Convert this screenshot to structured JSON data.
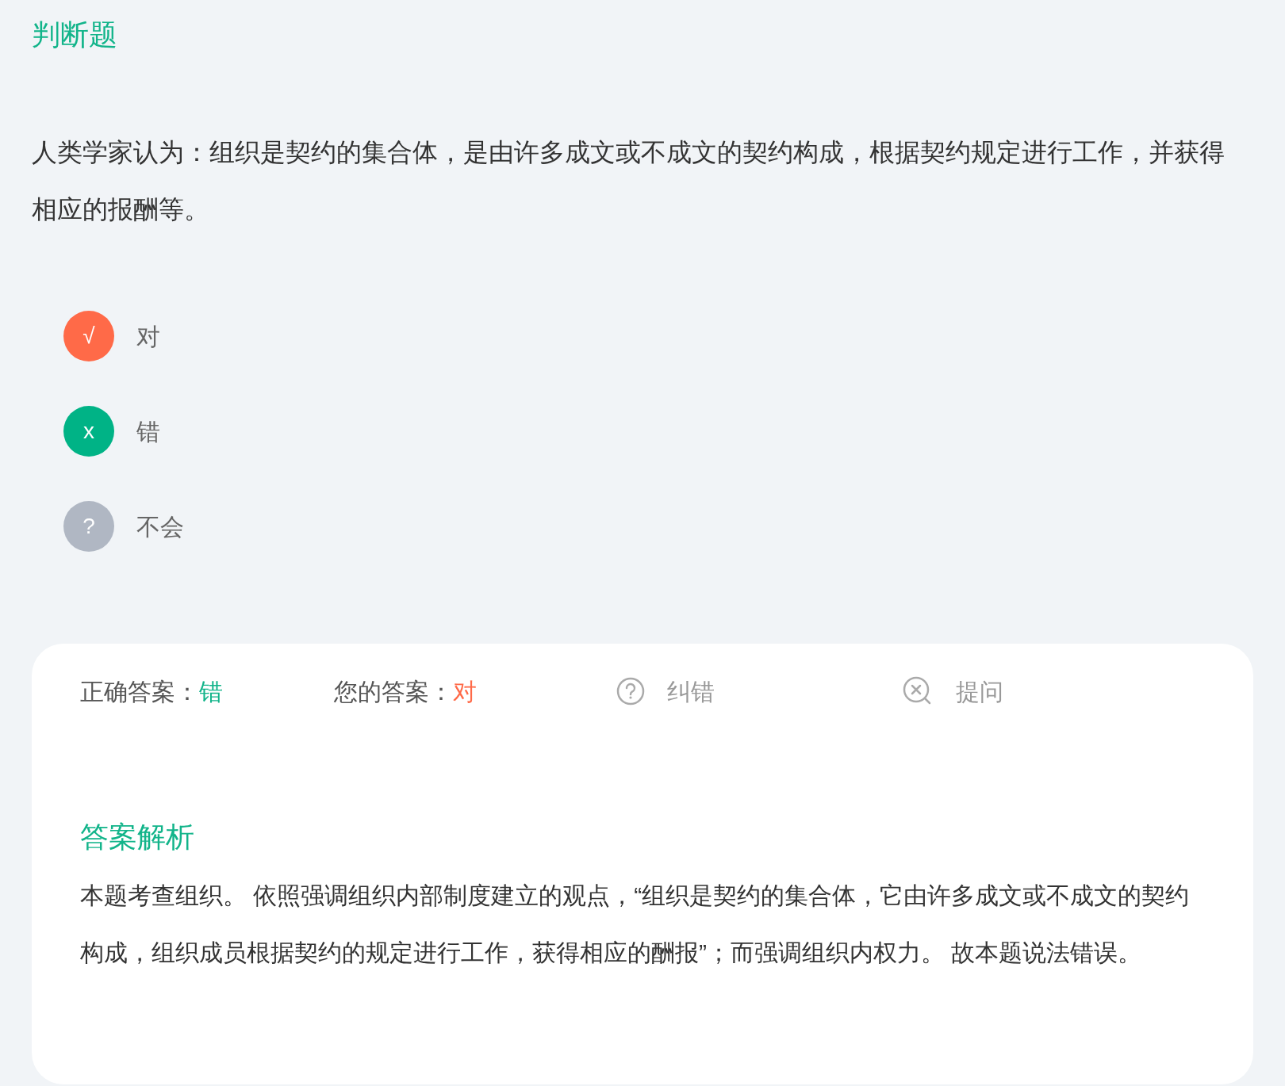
{
  "section_title": "判断题",
  "question": "人类学家认为：组织是契约的集合体，是由许多成文或不成文的契约构成，根据契约规定进行工作，并获得相应的报酬等。",
  "options": [
    {
      "symbol": "√",
      "label": "对",
      "color": "#ff6a48"
    },
    {
      "symbol": "x",
      "label": "错",
      "color": "#00b386"
    },
    {
      "symbol": "?",
      "label": "不会",
      "color": "#b0b7c3"
    }
  ],
  "result": {
    "correct_label": "正确答案：",
    "correct_value": "错",
    "your_label": "您的答案：",
    "your_value": "对",
    "actions": [
      {
        "kind": "report",
        "label": "纠错"
      },
      {
        "kind": "ask",
        "label": "提问"
      }
    ]
  },
  "analysis": {
    "title": "答案解析",
    "text": "本题考查组织。 依照强调组织内部制度建立的观点，“组织是契约的集合体，它由许多成文或不成文的契约构成，组织成员根据契约的规定进行工作，获得相应的酬报”；而强调组织内权力。 故本题说法错误。"
  }
}
